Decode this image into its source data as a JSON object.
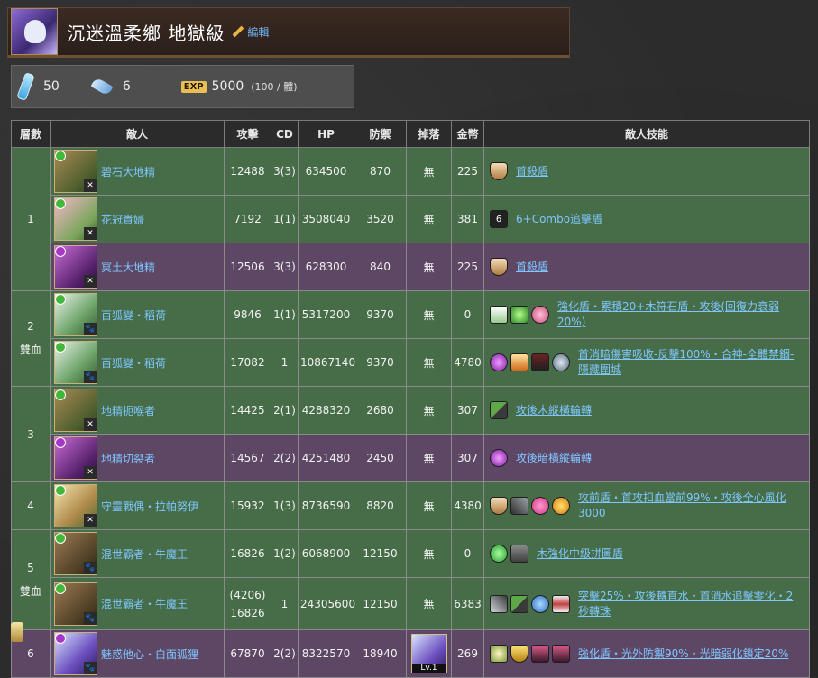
{
  "header": {
    "title": "沉迷溫柔鄉 地獄級",
    "edit_label": "編輯"
  },
  "stats": {
    "stamina": "50",
    "battles": "6",
    "exp_icon": "EXP",
    "exp": "5000",
    "exp_rate": "(100 / 體)"
  },
  "table": {
    "headers": [
      "層數",
      "敵人",
      "攻擊",
      "CD",
      "HP",
      "防禦",
      "掉落",
      "金幣",
      "敵人技能"
    ],
    "floors": [
      {
        "label": "1",
        "sub": ""
      },
      {
        "label": "2",
        "sub": "雙血"
      },
      {
        "label": "3",
        "sub": ""
      },
      {
        "label": "4",
        "sub": ""
      },
      {
        "label": "5",
        "sub": "雙血"
      },
      {
        "label": "6",
        "sub": ""
      }
    ],
    "rows": [
      {
        "name": "碧石大地精",
        "atk": "12488",
        "cd": "3(3)",
        "hp": "634500",
        "def": "870",
        "drop": "無",
        "gold": "225",
        "skill": "首殺盾"
      },
      {
        "name": "花冠貴婦",
        "atk": "7192",
        "cd": "1(1)",
        "hp": "3508040",
        "def": "3520",
        "drop": "無",
        "gold": "381",
        "skill": "6+Combo追擊盾",
        "combo_icon": "6"
      },
      {
        "name": "冥土大地精",
        "atk": "12506",
        "cd": "3(3)",
        "hp": "628300",
        "def": "840",
        "drop": "無",
        "gold": "225",
        "skill": "首殺盾"
      },
      {
        "name": "百狐變・稻荷",
        "atk": "9846",
        "cd": "1(1)",
        "hp": "5317200",
        "def": "9370",
        "drop": "無",
        "gold": "0",
        "skill": "強化盾・累積20+木符石盾・攻後(回復力衰弱20%)"
      },
      {
        "name": "百狐變・稻荷",
        "atk": "17082",
        "cd": "1",
        "hp": "10867140",
        "def": "9370",
        "drop": "無",
        "gold": "4780",
        "skill": "首消暗傷害吸收-反擊100%・合神-全體禁錮-隱藏圍城"
      },
      {
        "name": "地精扼喉者",
        "atk": "14425",
        "cd": "2(1)",
        "hp": "4288320",
        "def": "2680",
        "drop": "無",
        "gold": "307",
        "skill": "攻後木縱橫輪轉"
      },
      {
        "name": "地精切裂者",
        "atk": "14567",
        "cd": "2(2)",
        "hp": "4251480",
        "def": "2450",
        "drop": "無",
        "gold": "307",
        "skill": "攻後暗橫縱輪轉"
      },
      {
        "name": "守靈戰偶・拉帕努伊",
        "atk": "15932",
        "cd": "1(3)",
        "hp": "8736590",
        "def": "8820",
        "drop": "無",
        "gold": "4380",
        "skill": "攻前盾・首攻扣血當前99%・攻後全心風化3000"
      },
      {
        "name": "混世霸者・牛魔王",
        "atk": "16826",
        "cd": "1(2)",
        "hp": "6068900",
        "def": "12150",
        "drop": "無",
        "gold": "0",
        "skill": "木強化中級拼圖盾"
      },
      {
        "name": "混世霸者・牛魔王",
        "atk": "(4206)",
        "atk2": "16826",
        "cd": "1",
        "hp": "24305600",
        "def": "12150",
        "drop": "無",
        "gold": "6383",
        "skill": "突擊25%・攻後轉直水・首消水追擊零化・2秒轉珠"
      },
      {
        "name": "魅惑他心・白面狐狸",
        "atk": "67870",
        "cd": "2(2)",
        "hp": "8322570",
        "def": "18940",
        "drop_level": "Lv.1",
        "gold": "269",
        "skill": "強化盾・光外防禦90%・光暗弱化鎖定20%"
      }
    ]
  }
}
